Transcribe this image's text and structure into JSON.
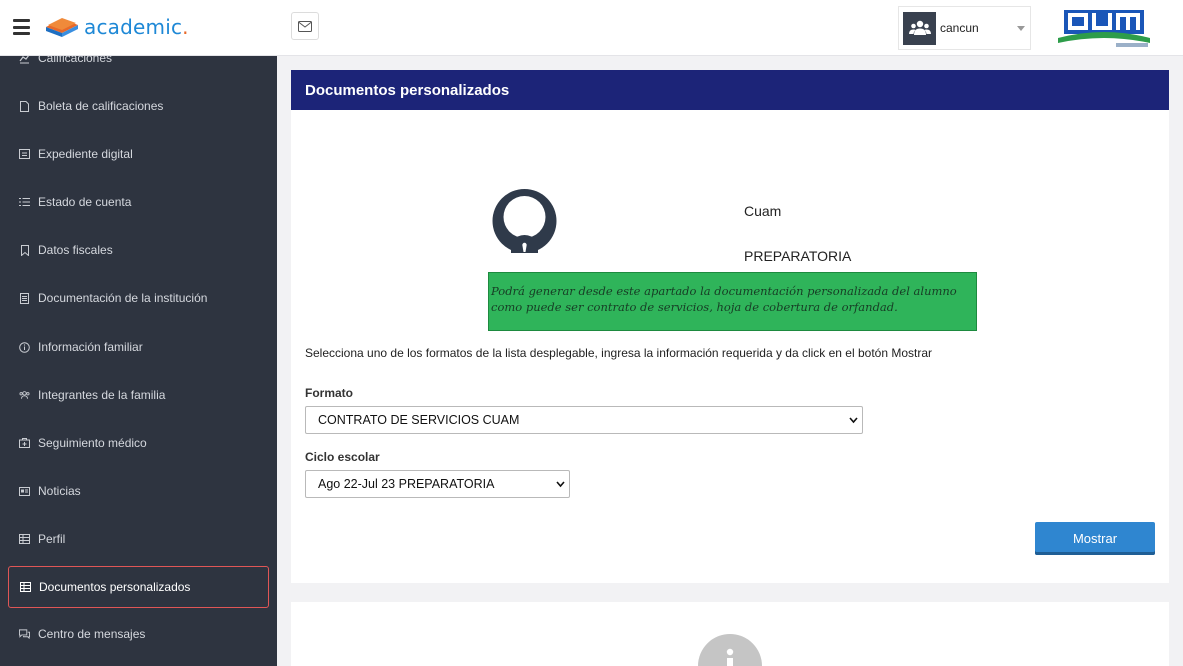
{
  "app": {
    "logo_text": "academic",
    "logo_suffix": "."
  },
  "header": {
    "user_name": "cancun"
  },
  "sidebar": {
    "items": [
      {
        "label": "Calificaciones",
        "icon": "chart-icon"
      },
      {
        "label": "Boleta de calificaciones",
        "icon": "file-icon"
      },
      {
        "label": "Expediente digital",
        "icon": "folder-icon"
      },
      {
        "label": "Estado de cuenta",
        "icon": "list-icon"
      },
      {
        "label": "Datos fiscales",
        "icon": "bookmark-icon"
      },
      {
        "label": "Documentación de la institución",
        "icon": "document-icon"
      },
      {
        "label": "Información familiar",
        "icon": "info-icon"
      },
      {
        "label": "Integrantes de la familia",
        "icon": "users-icon"
      },
      {
        "label": "Seguimiento médico",
        "icon": "medical-icon"
      },
      {
        "label": "Noticias",
        "icon": "newspaper-icon"
      },
      {
        "label": "Perfil",
        "icon": "table-icon"
      },
      {
        "label": "Documentos personalizados",
        "icon": "table-icon",
        "active": true
      },
      {
        "label": "Centro de mensajes",
        "icon": "chat-icon"
      }
    ]
  },
  "main": {
    "card_title": "Documentos personalizados",
    "institution_name": "Cuam",
    "institution_level": "PREPARATORIA",
    "notice": "Podrá generar desde este apartado la documentación personalizada del alumno como puede ser contrato de servicios, hoja de cobertura de orfandad.",
    "instructions": "Selecciona uno de los formatos de la lista desplegable, ingresa la información requerida y da click en el botón Mostrar",
    "format_label": "Formato",
    "format_value": "CONTRATO DE SERVICIOS CUAM",
    "cycle_label": "Ciclo escolar",
    "cycle_value": "Ago 22-Jul 23 PREPARATORIA",
    "show_button": "Mostrar"
  },
  "colors": {
    "sidebar_bg": "#2e3440",
    "header_bar": "#1c2478",
    "notice_bg": "#2fb45a",
    "primary_button": "#2f86d0",
    "active_outline": "#e05656"
  }
}
